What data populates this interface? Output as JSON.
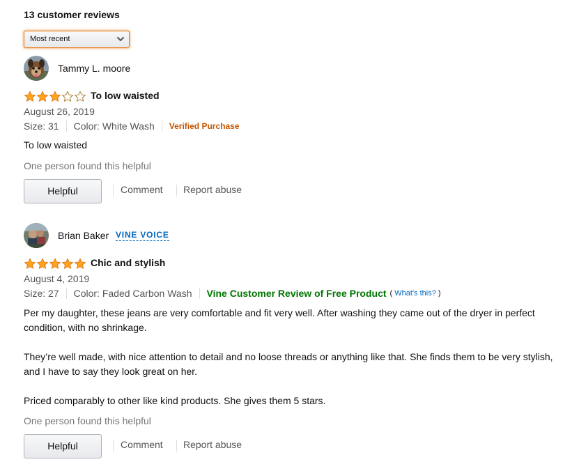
{
  "header": {
    "review_count": "13 customer reviews"
  },
  "sort": {
    "selected": "Most recent"
  },
  "reviews": [
    {
      "profile_name": "Tammy L. moore",
      "rating": 3,
      "title": "To low waisted",
      "date": "August 26, 2019",
      "size": "Size: 31",
      "color": "Color: White Wash",
      "badge": "Verified Purchase",
      "body": [
        "To low waisted"
      ],
      "helpful_text": "One person found this helpful",
      "helpful_label": "Helpful",
      "comment_label": "Comment",
      "report_label": "Report abuse"
    },
    {
      "profile_name": "Brian Baker",
      "vine_badge": "VINE VOICE",
      "rating": 5,
      "title": "Chic and stylish",
      "date": "August 4, 2019",
      "size": "Size: 27",
      "color": "Color: Faded Carbon Wash",
      "badge": "Vine Customer Review of Free Product",
      "whats_open": "(",
      "whats_link": "What's this?",
      "whats_close": ")",
      "body": [
        "Per my daughter, these jeans are very comfortable and fit very well. After washing they came out of the dryer in perfect condition, with no shrinkage.",
        "They’re well made, with nice attention to detail and no loose threads or anything like that. She finds them to be very stylish, and I have to say they look great on her.",
        "Priced comparably to other like kind products. She gives them 5 stars."
      ],
      "helpful_text": "One person found this helpful",
      "helpful_label": "Helpful",
      "comment_label": "Comment",
      "report_label": "Report abuse"
    }
  ],
  "colors": {
    "star": "#ffa41c",
    "star_border": "#de7921",
    "verified": "#c45500",
    "vine": "#007600",
    "link": "#0066c0"
  },
  "icons": {
    "sort_chevron": "chevron-down-icon",
    "star_full": "star-full-icon",
    "star_empty": "star-empty-icon"
  }
}
